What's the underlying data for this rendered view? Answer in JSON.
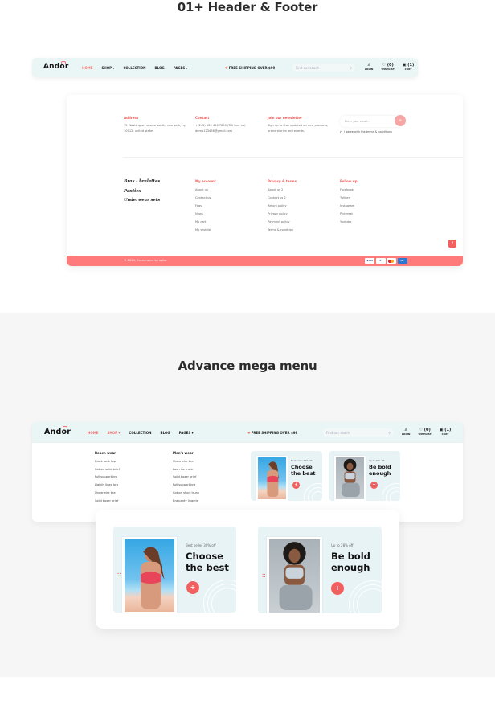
{
  "sections": {
    "header_footer_title": "01+ Header & Footer",
    "mega_menu_title": "Advance mega menu"
  },
  "header": {
    "logo": {
      "pre": "And",
      "o": "o",
      "post": "r"
    },
    "nav": [
      {
        "label": "HOME",
        "active": true
      },
      {
        "label": "SHOP ▾",
        "active": false
      },
      {
        "label": "COLLECTION",
        "active": false
      },
      {
        "label": "BLOG",
        "active": false
      },
      {
        "label": "PAGES ▾",
        "active": false
      }
    ],
    "shipping": "FREE SHIPPING OVER $99",
    "search_placeholder": "Find our seach",
    "icons": [
      {
        "name": "login",
        "glyph": "♙",
        "label": "LOGIN"
      },
      {
        "name": "wishlist",
        "glyph": "♡ (0)",
        "label": "WISHLIST"
      },
      {
        "name": "cart",
        "glyph": "▣ (1)",
        "label": "CART"
      }
    ]
  },
  "header_mega": {
    "nav": [
      {
        "label": "HOME",
        "active": true
      },
      {
        "label": "SHOP ▾",
        "active": true
      },
      {
        "label": "COLLECTION",
        "active": false
      },
      {
        "label": "BLOG",
        "active": false
      },
      {
        "label": "PAGES ▾",
        "active": false
      }
    ]
  },
  "footer": {
    "address": {
      "heading": "Address",
      "lines": [
        "75 Washington square south, new york, ny",
        "10012, united states"
      ]
    },
    "contact": {
      "heading": "Contact",
      "lines": [
        "+(243) 123 456 7890 (Toll free no)",
        "demo123456@gmail.com"
      ]
    },
    "newsletter": {
      "heading": "Join our newsletter",
      "lines": [
        "Sign up to stay updated on new products,",
        "brand stories and events."
      ],
      "email_placeholder": "Enter your email...",
      "submit_glyph": "✉",
      "agree_label": "I agree with the terms & conditions"
    },
    "categories": [
      "Bras - bralettes",
      "Panties",
      "Underwear sets"
    ],
    "my_account": {
      "heading": "My account",
      "links": [
        "About us",
        "Contact us",
        "Faqs",
        "News",
        "My cart",
        "My wishlist"
      ]
    },
    "privacy": {
      "heading": "Privacy & terms",
      "links": [
        "About us 2",
        "Contact us 2",
        "Return policy",
        "Privacy policy",
        "Payment policy",
        "Terms & condition"
      ]
    },
    "follow": {
      "heading": "Follow up",
      "links": [
        "Facebook",
        "Twitter",
        "Instagram",
        "Pinterest",
        "Youtube"
      ]
    },
    "back_to_top": "↑",
    "copyright": "© 2024, Ecommerce by spiko",
    "payments": [
      "VISA",
      "P",
      "",
      "AE"
    ]
  },
  "mega_menu": {
    "beach_wear": {
      "heading": "Beach wear",
      "items": [
        "Black tank top",
        "Cotton solid brief",
        "Full support bra",
        "Lightly lined bra",
        "Underwire bra",
        "Solid boxer brief"
      ]
    },
    "mens_wear": {
      "heading": "Men's wear",
      "items": [
        "Underwire bra",
        "Low rise trunk",
        "Solid boxer brief",
        "Full support bra",
        "Cotton short trunk",
        "Bra panty lingerie"
      ]
    },
    "promos": [
      {
        "kicker": "Best seller 30% off",
        "title_l1": "Choose",
        "title_l2": "the best",
        "button": "+"
      },
      {
        "kicker": "Up to 28% off",
        "title_l1": "Be bold",
        "title_l2": "enough",
        "button": "+"
      }
    ]
  },
  "colors": {
    "accent": "#f27474",
    "footer_bar": "#ff7a7a",
    "header_bg": "#eaf5f5",
    "promo_bg": "#e8f3f6"
  }
}
